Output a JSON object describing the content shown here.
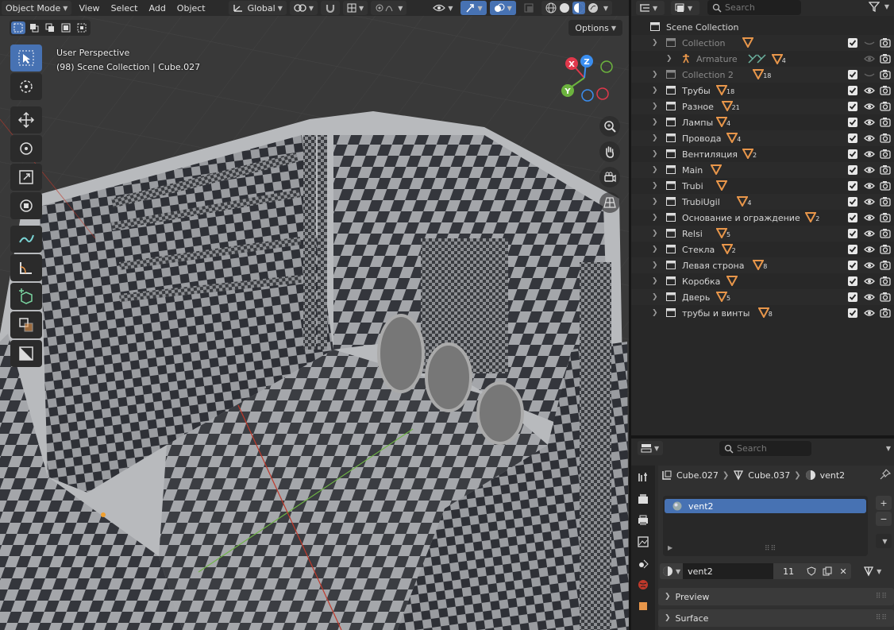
{
  "viewport": {
    "mode_label": "Object Mode",
    "menus": [
      "View",
      "Select",
      "Add",
      "Object"
    ],
    "transform_orientation": "Global",
    "options_label": "Options",
    "perspective": "User Perspective",
    "context": "(98) Scene Collection | Cube.027",
    "gizmo_axes": {
      "x": "X",
      "y": "Y",
      "z": "Z"
    }
  },
  "outliner": {
    "search_placeholder": "Search",
    "root_label": "Scene Collection",
    "rows": [
      {
        "name": "Collection",
        "badge": "",
        "dim": true
      },
      {
        "name": "Armature",
        "badge": "4",
        "dim": true
      },
      {
        "name": "Collection 2",
        "badge": "18",
        "dim": true
      },
      {
        "name": "Трубы",
        "badge": "18",
        "dim": false
      },
      {
        "name": "Разное",
        "badge": "21",
        "dim": false
      },
      {
        "name": "Лампы",
        "badge": "4",
        "dim": false
      },
      {
        "name": "Провода",
        "badge": "4",
        "dim": false
      },
      {
        "name": "Вентиляция",
        "badge": "2",
        "dim": false
      },
      {
        "name": "Main",
        "badge": "",
        "dim": false
      },
      {
        "name": "Trubi",
        "badge": "",
        "dim": false
      },
      {
        "name": "TrubiUgil",
        "badge": "4",
        "dim": false
      },
      {
        "name": "Основание и ограждение",
        "badge": "2",
        "dim": false
      },
      {
        "name": "Relsi",
        "badge": "5",
        "dim": false
      },
      {
        "name": "Стекла",
        "badge": "2",
        "dim": false
      },
      {
        "name": "Левая строна",
        "badge": "8",
        "dim": false
      },
      {
        "name": "Коробка",
        "badge": "",
        "dim": false
      },
      {
        "name": "Дверь",
        "badge": "5",
        "dim": false
      },
      {
        "name": "трубы и винты",
        "badge": "8",
        "dim": false
      }
    ]
  },
  "properties": {
    "search_placeholder": "Search",
    "breadcrumb": {
      "object": "Cube.027",
      "mesh": "Cube.037",
      "material": "vent2"
    },
    "slot_name": "vent2",
    "material_name": "vent2",
    "user_count": "11",
    "panels": [
      "Preview",
      "Surface"
    ]
  },
  "colors": {
    "accent": "#4772b3",
    "badge": "#e8964a",
    "header": "#2b2b2b"
  }
}
